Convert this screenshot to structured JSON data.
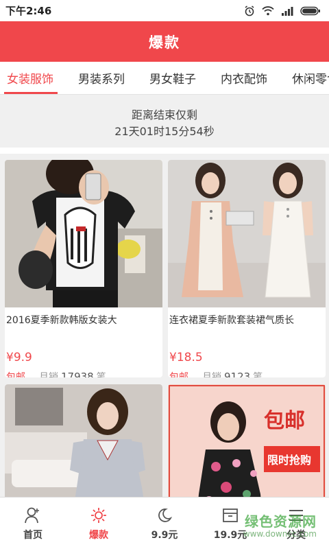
{
  "status_bar": {
    "time": "下午2:46"
  },
  "header": {
    "title": "爆款"
  },
  "tabs": [
    {
      "label": "女装服饰",
      "active": true
    },
    {
      "label": "男装系列",
      "active": false
    },
    {
      "label": "男女鞋子",
      "active": false
    },
    {
      "label": "内衣配饰",
      "active": false
    },
    {
      "label": "休闲零食",
      "active": false
    }
  ],
  "countdown": {
    "label": "距离结束仅剩",
    "value": "21天01时15分54秒"
  },
  "products": [
    {
      "name": "2016夏季新款韩版女装大",
      "price": "¥9.9",
      "shipping": "包邮",
      "sales_label": "月销",
      "sales_count": "17938",
      "sales_unit": "笔"
    },
    {
      "name": "连衣裙夏季新款套装裙气质长",
      "price": "¥18.5",
      "shipping": "包邮",
      "sales_label": "月销",
      "sales_count": "9123",
      "sales_unit": "笔"
    },
    {
      "name": "",
      "price": "",
      "shipping": "",
      "sales_label": "",
      "sales_count": "",
      "sales_unit": ""
    },
    {
      "name": "",
      "price": "",
      "shipping": "",
      "sales_label": "",
      "sales_count": "",
      "sales_unit": "",
      "banner_text_1": "包邮",
      "banner_text_2": "限时抢购"
    }
  ],
  "bottom_nav": [
    {
      "label": "首页",
      "icon": "home-person-icon",
      "active": false
    },
    {
      "label": "爆款",
      "icon": "sun-icon",
      "active": true
    },
    {
      "label": "9.9元",
      "icon": "moon-icon",
      "active": false
    },
    {
      "label": "19.9元",
      "icon": "box-icon",
      "active": false
    },
    {
      "label": "分类",
      "icon": "menu-icon",
      "active": false
    }
  ],
  "watermark": {
    "line1": "绿色资源网",
    "line2": "www.downcc.com"
  },
  "colors": {
    "accent": "#f0474b",
    "background": "#f0f0f0"
  }
}
